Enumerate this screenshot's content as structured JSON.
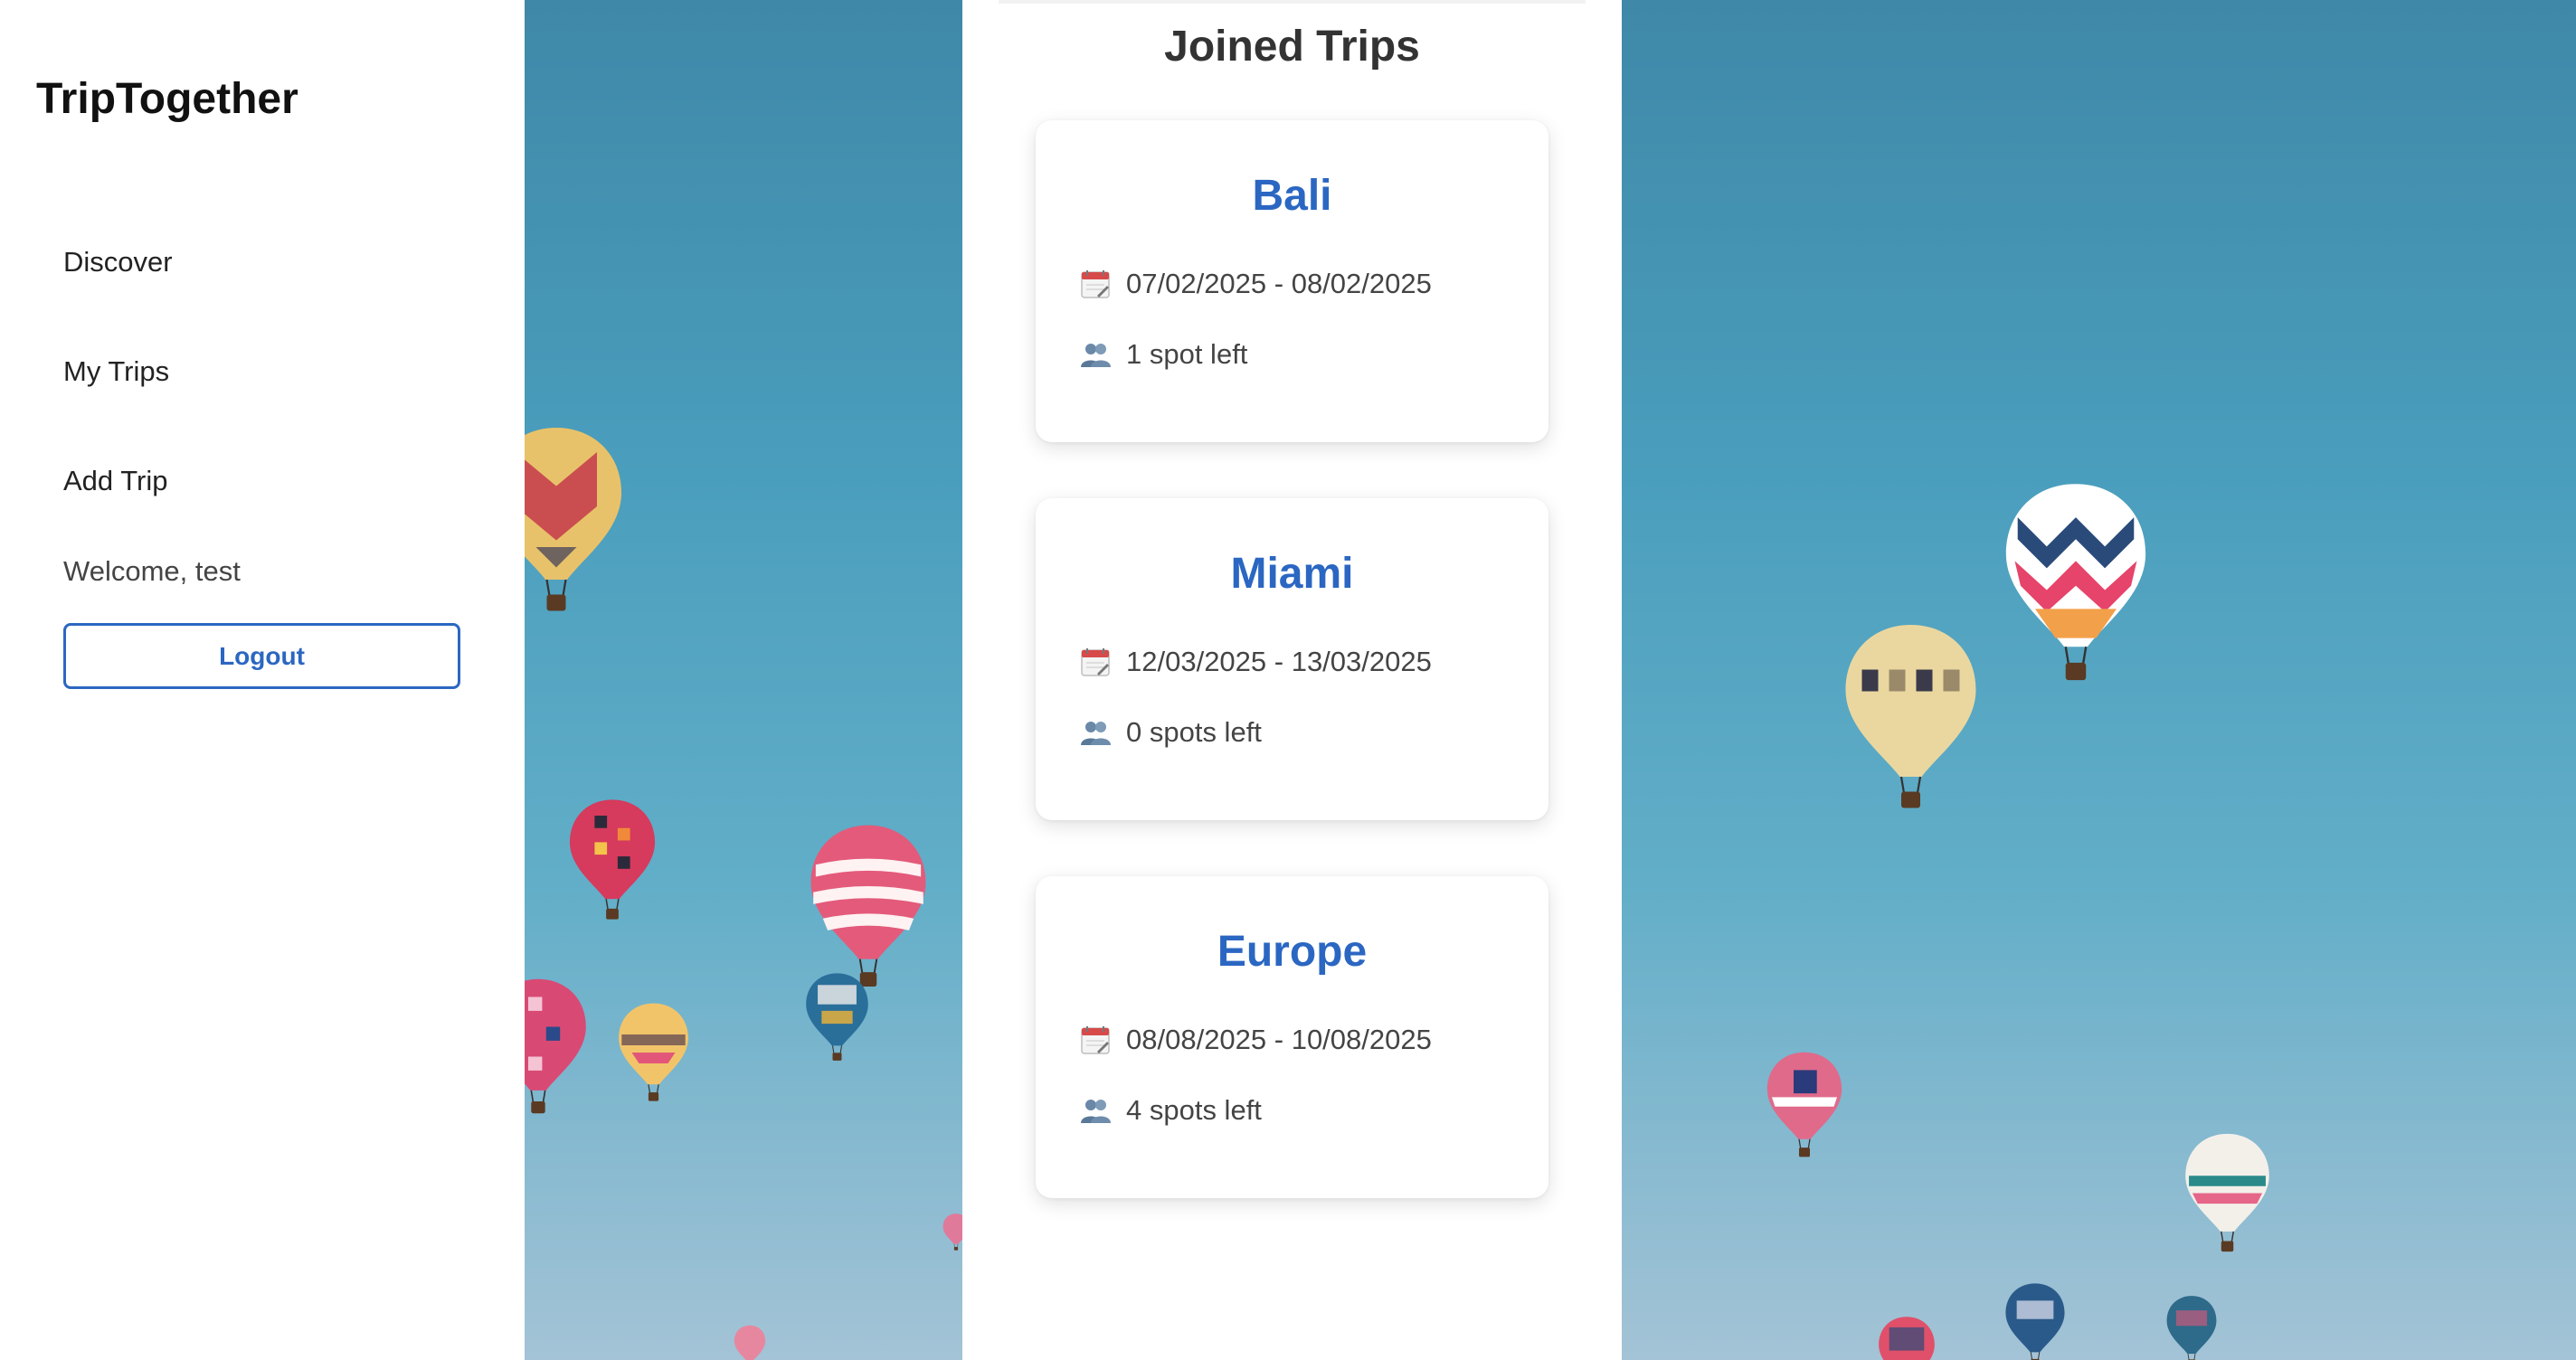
{
  "app": {
    "brand": "TripTogether"
  },
  "sidebar": {
    "items": [
      {
        "label": "Discover"
      },
      {
        "label": "My Trips"
      },
      {
        "label": "Add Trip"
      }
    ],
    "welcome": "Welcome, test",
    "logout_label": "Logout"
  },
  "main": {
    "title": "Joined Trips",
    "trips": [
      {
        "name": "Bali",
        "dates": "07/02/2025 - 08/02/2025",
        "spots": "1 spot left"
      },
      {
        "name": "Miami",
        "dates": "12/03/2025 - 13/03/2025",
        "spots": "0 spots left"
      },
      {
        "name": "Europe",
        "dates": "08/08/2025 - 10/08/2025",
        "spots": "4 spots left"
      }
    ]
  },
  "icons": {
    "date": "calendar-icon",
    "spots": "people-icon"
  },
  "colors": {
    "accent": "#2b67c2",
    "sky": "#4a9ebd",
    "text": "#333333"
  }
}
